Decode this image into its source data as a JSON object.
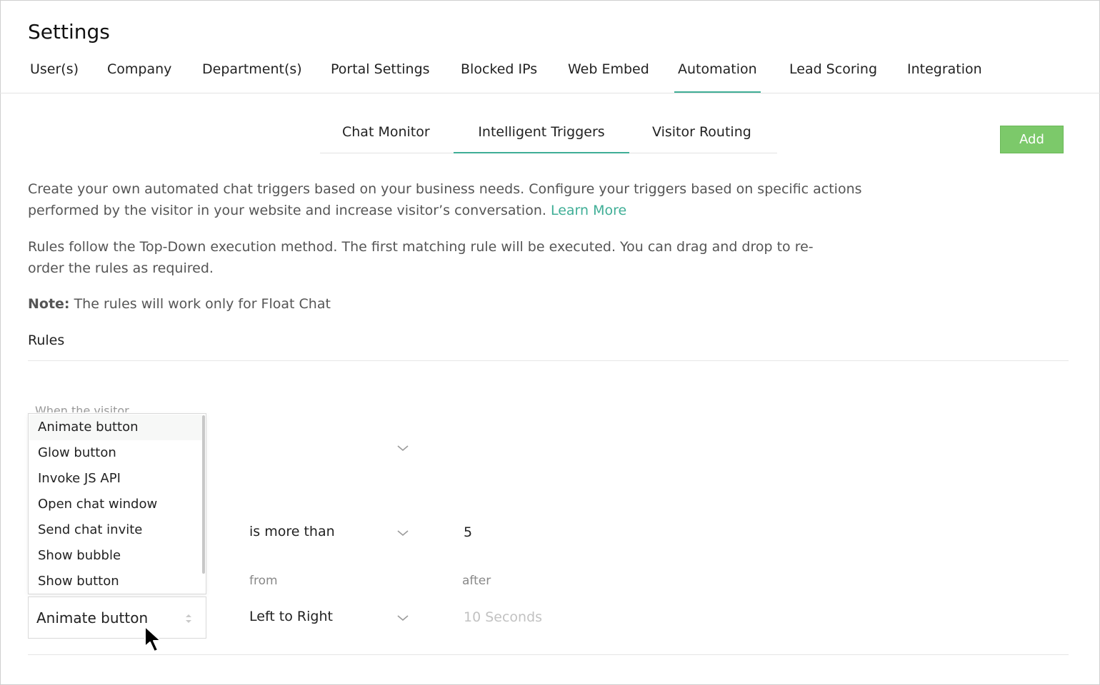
{
  "page": {
    "title": "Settings"
  },
  "main_tabs": [
    {
      "label": "User(s)"
    },
    {
      "label": "Company"
    },
    {
      "label": "Department(s)"
    },
    {
      "label": "Portal Settings"
    },
    {
      "label": "Blocked IPs"
    },
    {
      "label": "Web Embed"
    },
    {
      "label": "Automation",
      "active": true
    },
    {
      "label": "Lead Scoring"
    },
    {
      "label": "Integration"
    }
  ],
  "sub_tabs": [
    {
      "label": "Chat Monitor"
    },
    {
      "label": "Intelligent Triggers",
      "active": true
    },
    {
      "label": "Visitor Routing"
    }
  ],
  "add_button": {
    "label": "Add"
  },
  "description": {
    "line1": "Create your own automated chat triggers based on your business needs. Configure your triggers based on specific actions",
    "line2": "performed by the visitor in your website and increase visitor’s conversation.",
    "learn_more": "Learn More"
  },
  "rules_info": {
    "line1": "Rules follow the Top-Down execution method. The first matching rule will be executed. You can drag and drop to re-",
    "line2": "order the rules as required."
  },
  "note": {
    "label": "Note:",
    "text": "The rules will work only for Float Chat"
  },
  "rules": {
    "heading": "Rules",
    "when_label": "When the visitor",
    "condition_operator": "is more than",
    "condition_value": "5",
    "from_label": "from",
    "after_label": "after",
    "direction": "Left to Right",
    "after_placeholder": "10 Seconds"
  },
  "action_dropdown": {
    "selected": "Animate button",
    "options": [
      "Animate button",
      "Glow button",
      "Invoke JS API",
      "Open chat window",
      "Send chat invite",
      "Show bubble",
      "Show button"
    ],
    "highlighted_index": 0
  },
  "colors": {
    "accent": "#3fae96",
    "add_button": "#7cc96a"
  },
  "icons": [
    "chevron-down-icon",
    "select-arrows-icon",
    "mouse-pointer-icon"
  ]
}
